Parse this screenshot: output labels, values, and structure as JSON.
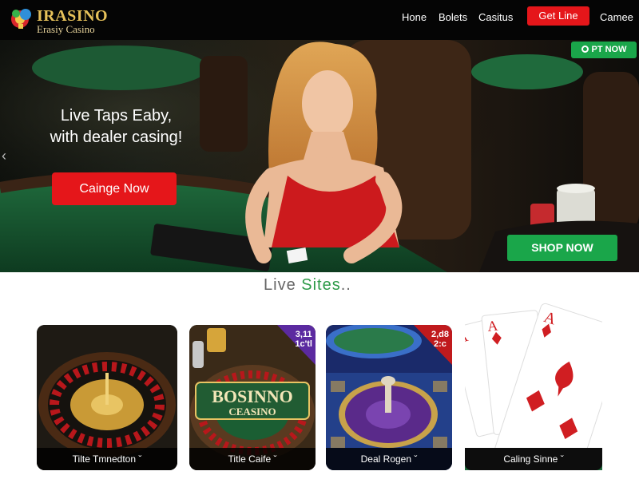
{
  "header": {
    "logo_title": "IRASINO",
    "logo_subtitle": "Erasiy Casino",
    "nav": {
      "home": "Hone",
      "bolets": "Bolets",
      "casino": "Casitus",
      "cta": "Get Line",
      "camee": "Camee"
    }
  },
  "hero": {
    "heading_line1": "Live Taps Eaby,",
    "heading_line2": "with dealer casing!",
    "cta": "Cainge Now",
    "live_badge": "PT NOW",
    "shop": "SHOP NOW",
    "arrow": "‹"
  },
  "section": {
    "title_part1": "Live",
    "title_part2": "Sites",
    "title_part3": ".."
  },
  "cards": [
    {
      "label": "Tilte Tmnedton ˇ"
    },
    {
      "label": "Title Caife ˇ",
      "badge_top": "3,11",
      "badge_bottom": "1c'tl",
      "logo_line1": "BOSINNO",
      "logo_line2": "CEASINO"
    },
    {
      "label": "Deal Rogen ˇ",
      "badge_top": "2,d8",
      "badge_bottom": "2:c"
    },
    {
      "label": "Caling Sinne ˇ"
    }
  ],
  "colors": {
    "accent_red": "#e5161a",
    "accent_green": "#1aa64a",
    "gold": "#e6c15a"
  },
  "icons": {
    "logo": "casino-chip-logo-icon",
    "live_badge": "live-indicator-icon",
    "slider_prev": "chevron-left-icon"
  }
}
